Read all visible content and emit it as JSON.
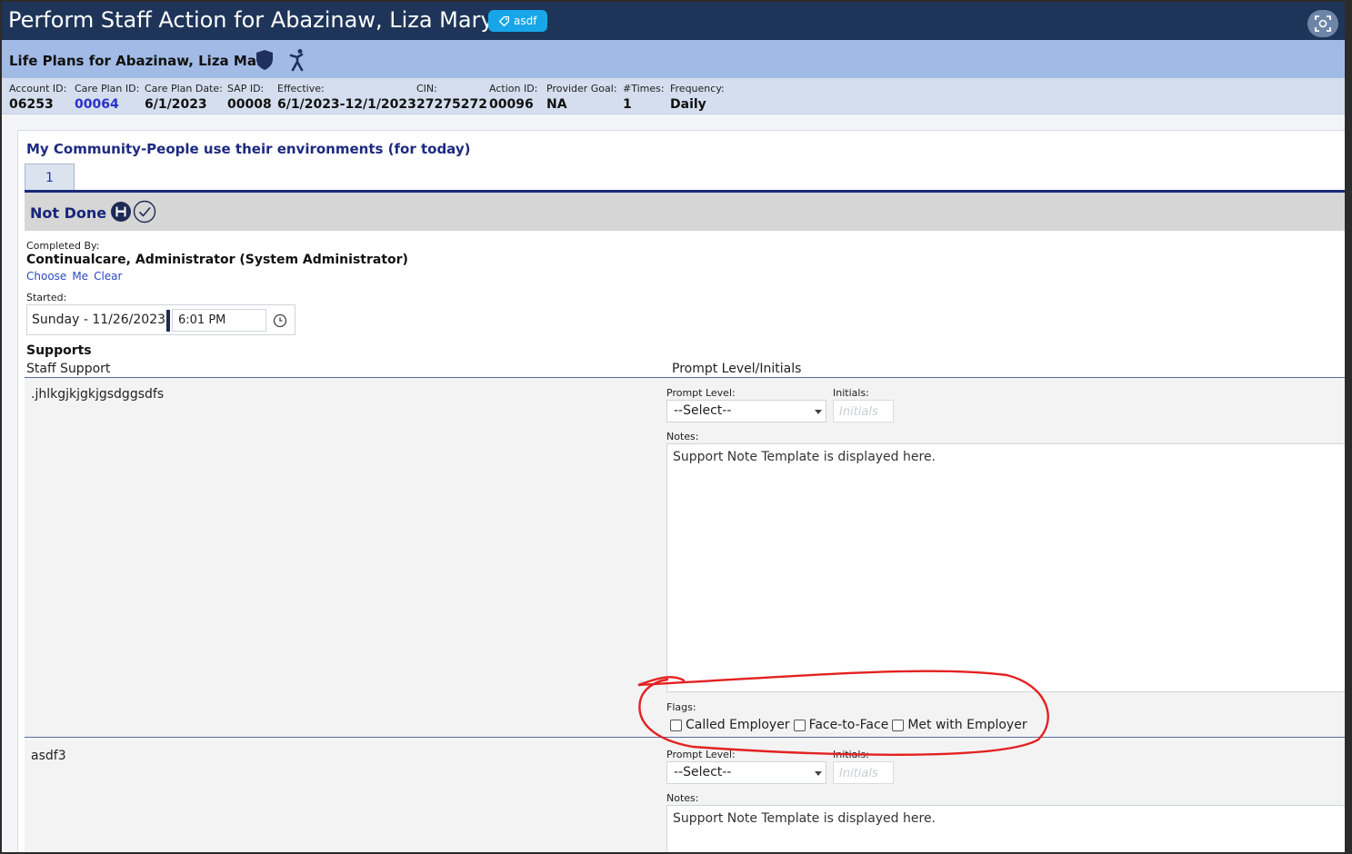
{
  "window": {
    "title": "Perform Staff Action for Abazinaw, Liza Mary",
    "tag_label": "asdf"
  },
  "life_plan": {
    "title": "Life Plans for Abazinaw, Liza Mary"
  },
  "info": [
    {
      "label": "Account ID:",
      "value": "06253",
      "link": false
    },
    {
      "label": "Care Plan ID:",
      "value": "00064",
      "link": true
    },
    {
      "label": "Care Plan Date:",
      "value": "6/1/2023",
      "link": false
    },
    {
      "label": "SAP ID:",
      "value": "00008",
      "link": false
    },
    {
      "label": "Effective:",
      "value": "6/1/2023-12/1/2023",
      "link": false
    },
    {
      "label": "CIN:",
      "value": "27275272",
      "link": false
    },
    {
      "label": "Action ID:",
      "value": "00096",
      "link": false
    },
    {
      "label": "Provider Goal:",
      "value": "NA",
      "link": false
    },
    {
      "label": "#Times:",
      "value": "1",
      "link": false
    },
    {
      "label": "Frequency:",
      "value": "Daily",
      "link": false
    }
  ],
  "goal": {
    "title": "My Community-People use their environments (for today)",
    "tab_label": "1",
    "status": "Not Done"
  },
  "completed": {
    "label": "Completed By:",
    "name": "Continualcare, Administrator (System Administrator)",
    "links": [
      "Choose",
      "Me",
      "Clear"
    ]
  },
  "started": {
    "label": "Started:",
    "date": "Sunday - 11/26/2023:",
    "time": "6:01 PM"
  },
  "supports": {
    "title": "Supports",
    "col_staff": "Staff Support",
    "col_prompt": "Prompt Level/Initials",
    "prompt_label": "Prompt Level:",
    "initials_label": "Initials:",
    "initials_placeholder": "Initials",
    "select_default": "--Select--",
    "notes_label": "Notes:",
    "notes_template": "Support Note Template is displayed here.",
    "flags_label": "Flags:",
    "flags": [
      "Called Employer",
      "Face-to-Face",
      "Met with Employer"
    ],
    "rows": [
      {
        "name": ".jhlkgjkjgkjgsdggsdfs"
      },
      {
        "name": "asdf3"
      }
    ]
  },
  "colors": {
    "title_bar": "#1e3559",
    "accent_badge": "#17a7e8",
    "header_blue": "#a2bbe6",
    "annotation_red": "#e32121"
  }
}
